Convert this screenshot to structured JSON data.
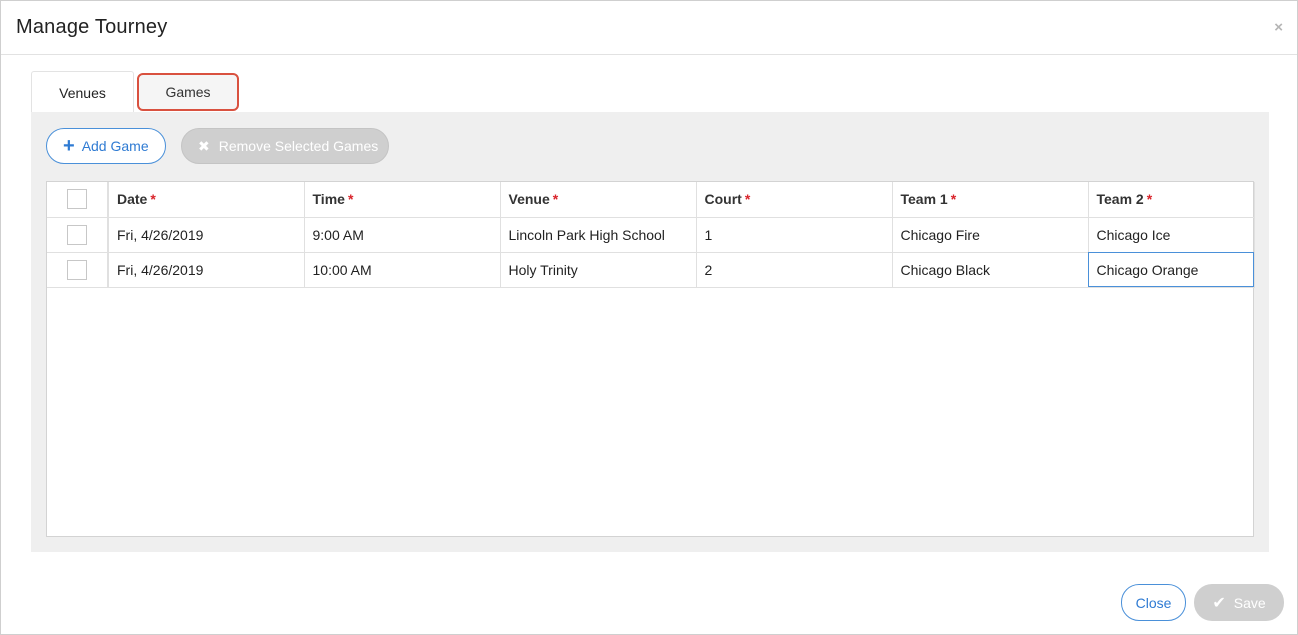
{
  "modal": {
    "title": "Manage Tourney",
    "close_glyph": "×"
  },
  "tabs": [
    {
      "label": "Venues"
    },
    {
      "label": "Games"
    }
  ],
  "toolbar": {
    "add_label": "Add Game",
    "remove_label": "Remove Selected Games"
  },
  "table": {
    "columns": [
      "Date",
      "Time",
      "Venue",
      "Court",
      "Team 1",
      "Team 2"
    ],
    "rows": [
      {
        "date": "Fri, 4/26/2019",
        "time": "9:00 AM",
        "venue": "Lincoln Park High School",
        "court": "1",
        "team1": "Chicago Fire",
        "team2": "Chicago Ice"
      },
      {
        "date": "Fri, 4/26/2019",
        "time": "10:00 AM",
        "venue": "Holy Trinity",
        "court": "2",
        "team1": "Chicago Black",
        "team2": "Chicago Orange"
      }
    ]
  },
  "footer": {
    "close_label": "Close",
    "save_label": "Save"
  },
  "colors": {
    "accent": "#2f7bd3",
    "required": "#d9242b",
    "highlight": "#d9513f",
    "disabled": "#cfcfcf"
  }
}
